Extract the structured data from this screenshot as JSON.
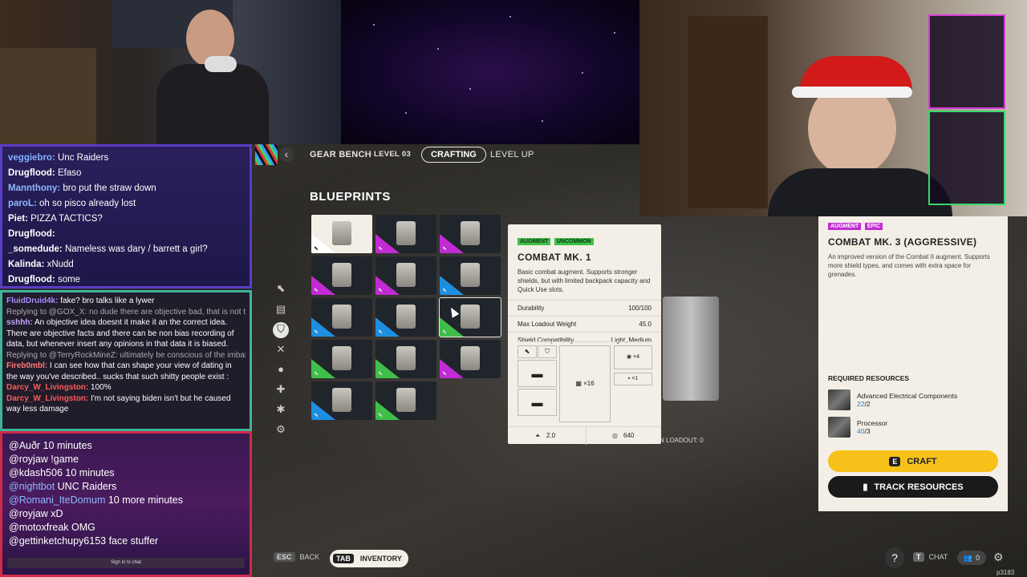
{
  "header": {
    "back_glyph": "‹",
    "title": "GEAR BENCH",
    "level": "LEVEL 03",
    "tab_active": "CRAFTING",
    "tab_other": "LEVEL UP"
  },
  "blueprints_title": "BLUEPRINTS",
  "item_card": {
    "tag_type": "AUGMENT",
    "tag_rarity": "UNCOMMON",
    "name": "COMBAT MK. 1",
    "description": "Basic combat augment. Supports stronger shields, but with limited backpack capacity and Quick Use slots.",
    "stats": [
      {
        "label": "Durability",
        "value": "100/100"
      },
      {
        "label": "Max Loadout Weight",
        "value": "45.0"
      },
      {
        "label": "Shield Compatibility",
        "value": "Light, Medium"
      }
    ],
    "slot_grid": "×16",
    "slot_right_1": "×4",
    "slot_right_2": "×1",
    "weight": "2.0",
    "price": "640"
  },
  "loadout_text": "N LOADOUT: 0",
  "right_panel": {
    "tag_type": "AUGMENT",
    "tag_rarity": "EPIC",
    "name": "COMBAT MK. 3 (AGGRESSIVE)",
    "description": "An improved version of the Combat II augment. Supports more shield types, and comes with extra space for grenades.",
    "required_title": "REQUIRED RESOURCES",
    "resources": [
      {
        "name": "Advanced Electrical Components",
        "have": "22",
        "need": "/2"
      },
      {
        "name": "Processor",
        "have": "40",
        "need": "/3"
      }
    ],
    "craft_key": "E",
    "craft_label": "CRAFT",
    "track_label": "TRACK RESOURCES"
  },
  "footer": {
    "esc_key": "ESC",
    "back_label": "BACK",
    "tab_key": "TAB",
    "inventory_label": "INVENTORY",
    "chat_key": "T",
    "chat_label": "CHAT",
    "party_count": "0",
    "overlay_id": "p3183"
  },
  "chat_top": [
    {
      "user": "veggiebro:",
      "color": "#7fb3ff",
      "msg": " Unc Raiders"
    },
    {
      "user": "Drugflood:",
      "color": "#ffffff",
      "msg": " Efaso"
    },
    {
      "user": "Mannthony:",
      "color": "#8fb8ff",
      "msg": " bro put the straw down"
    },
    {
      "user": "paroL:",
      "color": "#8fb8ff",
      "msg": " oh so pisco already lost"
    },
    {
      "user": "Piet:",
      "color": "#ffffff",
      "msg": " PIZZA TACTICS?"
    },
    {
      "user": "Drugflood:",
      "color": "#ffffff",
      "msg": ""
    },
    {
      "user": "_somedude:",
      "color": "#ffffff",
      "msg": " Nameless was dary / barrett a girl?"
    },
    {
      "user": "Kalinda:",
      "color": "#ffffff",
      "msg": " xNudd"
    },
    {
      "user": "Drugflood:",
      "color": "#ffffff",
      "msg": " some"
    }
  ],
  "chat_mid": [
    {
      "user": "FluidDruid4k:",
      "color": "#a98bff",
      "msg": " fake? bro talks like a lywer"
    },
    {
      "user": "",
      "color": "#aaa",
      "msg": "Replying to @GOX_X: no dude there are objective bad, that is not taking a si"
    },
    {
      "user": "sshhh:",
      "color": "#c7a6ff",
      "msg": " An objective idea doesnt it make it an the correct idea."
    },
    {
      "user": "",
      "color": "#fff",
      "msg": "There are objective facts and there can be non bias recording of"
    },
    {
      "user": "",
      "color": "#fff",
      "msg": "data, but whenever insert any opinions in that data it is biased."
    },
    {
      "user": "",
      "color": "#aaa",
      "msg": "Replying to @TerryRockMineZ: ultimately be conscious of the imbalance"
    },
    {
      "user": "Fireb0mbl:",
      "color": "#ff7a7a",
      "msg": " I can see how that can shape your view of dating in"
    },
    {
      "user": "",
      "color": "#fff",
      "msg": "the way you've described.. sucks that such shitty people exist :"
    },
    {
      "user": "Darcy_W_Livingston:",
      "color": "#ff5a5a",
      "msg": " 100%"
    },
    {
      "user": "Darcy_W_Livingston:",
      "color": "#ff5a5a",
      "msg": " I'm not saying biden isn't but he caused"
    },
    {
      "user": "",
      "color": "#fff",
      "msg": "way less damage"
    }
  ],
  "chat_bot": [
    {
      "user": "@Auðr",
      "color": "#ffffff",
      "msg": " 10 minutes"
    },
    {
      "user": "@royjaw",
      "color": "#ffffff",
      "msg": " !game"
    },
    {
      "user": "@kdash506",
      "color": "#ffffff",
      "msg": " 10 minutes"
    },
    {
      "user": "@nightbot",
      "color": "#8fb8ff",
      "msg": " UNC Raiders"
    },
    {
      "user": "@Romani_IteDomum",
      "color": "#8fb8ff",
      "msg": " 10 more minutes"
    },
    {
      "user": "@royjaw",
      "color": "#ffffff",
      "msg": " xD"
    },
    {
      "user": "@motoxfreak",
      "color": "#ffffff",
      "msg": " OMG"
    },
    {
      "user": "@gettinketchupy6153",
      "color": "#ffffff",
      "msg": " face stuffer"
    }
  ],
  "chat_signin": "Sign in to chat",
  "colors": {
    "uncommon": "#3fbf4a",
    "epic": "#c02bd3",
    "craft_yellow": "#f6c21a"
  },
  "tiles": [
    {
      "rarity": "#ffffff",
      "selected": true
    },
    {
      "rarity": "#c02bd3"
    },
    {
      "rarity": "#c02bd3"
    },
    {
      "rarity": "#c02bd3"
    },
    {
      "rarity": "#c02bd3"
    },
    {
      "rarity": "#1e8ee0"
    },
    {
      "rarity": "#1e8ee0"
    },
    {
      "rarity": "#1e8ee0"
    },
    {
      "rarity": "#3fbf4a",
      "hover": true
    },
    {
      "rarity": "#3fbf4a"
    },
    {
      "rarity": "#3fbf4a"
    },
    {
      "rarity": "#c02bd3"
    },
    {
      "rarity": "#1e8ee0"
    },
    {
      "rarity": "#3fbf4a"
    }
  ]
}
